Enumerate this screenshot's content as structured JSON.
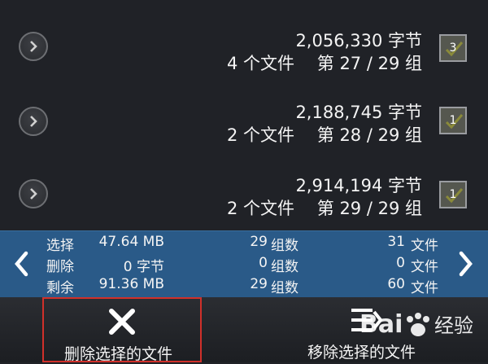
{
  "groups": [
    {
      "bytes": "2,056,330 字节",
      "files": "4 个文件",
      "group": "第 27 / 29 组",
      "checked_count": "3"
    },
    {
      "bytes": "2,188,745 字节",
      "files": "2 个文件",
      "group": "第 28 / 29 组",
      "checked_count": "1"
    },
    {
      "bytes": "2,914,194 字节",
      "files": "2 个文件",
      "group": "第 29 / 29 组",
      "checked_count": "1"
    }
  ],
  "stats": [
    {
      "label": "选择",
      "value": "47.64 MB",
      "groups_num": "29",
      "groups_label": "组数",
      "files_num": "31",
      "files_label": "文件"
    },
    {
      "label": "删除",
      "value": "0 字节",
      "groups_num": "0",
      "groups_label": "组数",
      "files_num": "0",
      "files_label": "文件"
    },
    {
      "label": "剩余",
      "value": "91.36 MB",
      "groups_num": "29",
      "groups_label": "组数",
      "files_num": "60",
      "files_label": "文件"
    }
  ],
  "actions": {
    "delete_label": "删除选择的文件",
    "move_label": "移除选择的文件"
  },
  "watermark": {
    "text": "Bai 经验"
  },
  "colors": {
    "stats_bg": "#2a5a88",
    "highlight": "#d0302a",
    "check": "#8a8a3a"
  }
}
